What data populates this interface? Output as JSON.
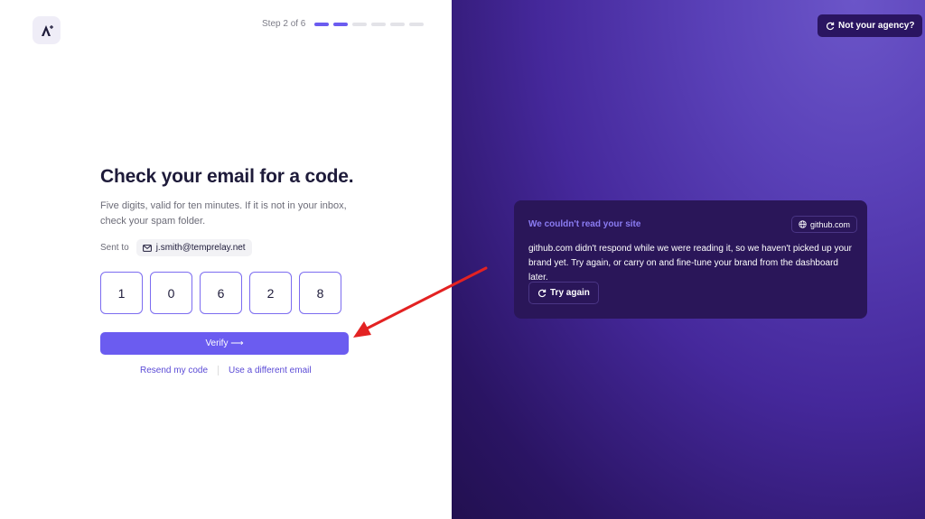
{
  "stepper": {
    "label": "Step 2 of 6",
    "total": 6,
    "current": 2
  },
  "form": {
    "title": "Check your email for a code.",
    "description": "Five digits, valid for ten minutes. If it is not in your inbox, check your spam folder.",
    "sent_to_label": "Sent to",
    "email": "j.smith@temprelay.net",
    "digits": [
      "1",
      "0",
      "6",
      "2",
      "8"
    ],
    "verify_label": "Verify ⟶",
    "resend_label": "Resend my code",
    "different_email_label": "Use a different email"
  },
  "right": {
    "not_agency_label": "Not your agency?",
    "card": {
      "title": "We couldn't read your site",
      "site": "github.com",
      "body": "github.com didn't respond while we were reading it, so we haven't picked up your brand yet. Try again, or carry on and fine-tune your brand from the dashboard later.",
      "try_again_label": "Try again"
    }
  },
  "icons": {
    "logo": "logo-icon",
    "mail": "mail-icon",
    "globe": "globe-icon",
    "refresh": "refresh-icon"
  },
  "colors": {
    "accent": "#6b5cf0",
    "panel": "#45289b",
    "card": "#2a1659",
    "annotation": "#e32222"
  }
}
